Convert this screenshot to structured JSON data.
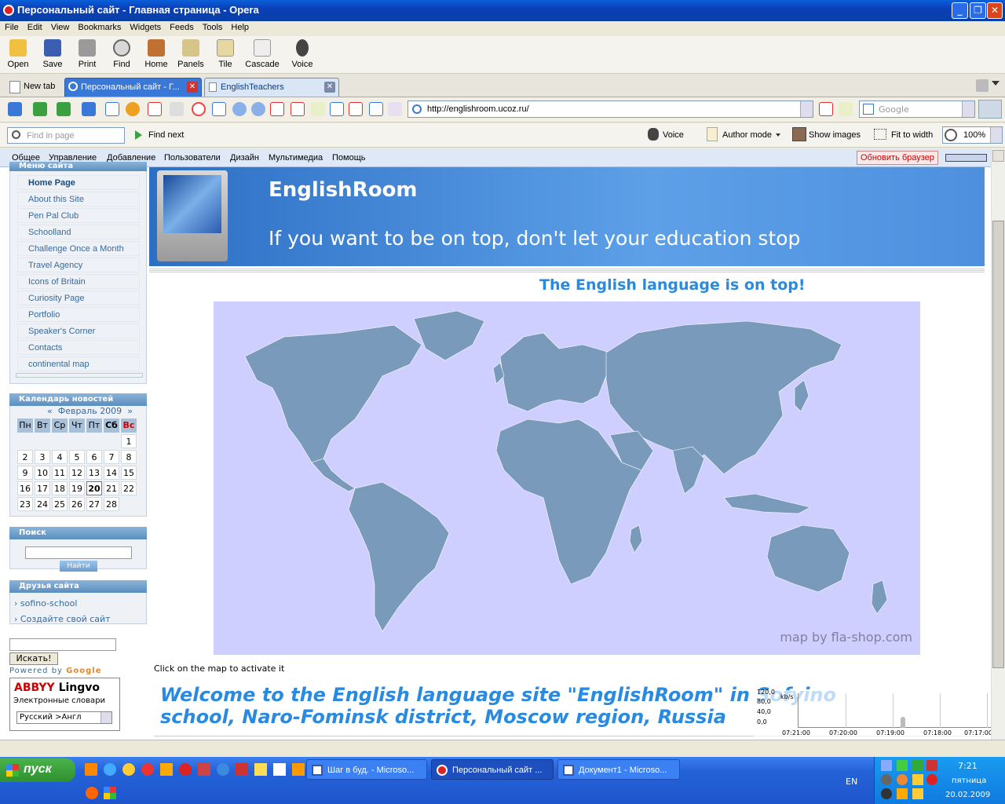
{
  "window": {
    "title": "Персональный сайт - Главная страница - Opera"
  },
  "menubar": [
    "File",
    "Edit",
    "View",
    "Bookmarks",
    "Widgets",
    "Feeds",
    "Tools",
    "Help"
  ],
  "toolbar": {
    "open": "Open",
    "save": "Save",
    "print": "Print",
    "find": "Find",
    "home": "Home",
    "panels": "Panels",
    "tile": "Tile",
    "cascade": "Cascade",
    "voice": "Voice"
  },
  "tabs": {
    "new_tab": "New tab",
    "tab1": "Персональный сайт - Г...",
    "tab2": "EnglishTeachers"
  },
  "address": {
    "url": "http://englishroom.ucoz.ru/",
    "search_placeholder": "Google"
  },
  "findbar": {
    "placeholder": "Find in page",
    "find_next": "Find next",
    "voice": "Voice",
    "author_mode": "Author mode",
    "show_images": "Show images",
    "fit_to_width": "Fit to width",
    "zoom": "100%"
  },
  "ucoz_bar": {
    "items": [
      "Общее",
      "Управление",
      "Добавление",
      "Пользователи",
      "Дизайн",
      "Мультимедиа",
      "Помощь"
    ],
    "refresh": "Обновить браузер"
  },
  "site": {
    "menu_header": "Меню сайта",
    "menu": [
      "Home Page",
      "About this Site",
      "Pen Pal Club",
      "Schoolland",
      "Challenge Once a Month",
      "Travel Agency",
      "Icons of Britain",
      "Curiosity Page",
      "Portfolio",
      "Speaker's Corner",
      "Contacts",
      "continental map"
    ],
    "calendar_header": "Календарь новостей",
    "calendar_month": "Февраль 2009",
    "calendar_prev": "«",
    "calendar_next": "»",
    "weekdays": [
      "Пн",
      "Вт",
      "Ср",
      "Чт",
      "Пт",
      "Сб",
      "Вс"
    ],
    "days": [
      "",
      "",
      "",
      "",
      "",
      "",
      "1",
      "2",
      "3",
      "4",
      "5",
      "6",
      "7",
      "8",
      "9",
      "10",
      "11",
      "12",
      "13",
      "14",
      "15",
      "16",
      "17",
      "18",
      "19",
      "20",
      "21",
      "22",
      "23",
      "24",
      "25",
      "26",
      "27",
      "28",
      ""
    ],
    "today": "20",
    "search_header": "Поиск",
    "search_button": "Найти",
    "friends_header": "Друзья сайта",
    "friends": [
      "sofino-school",
      "Создайте свой сайт"
    ],
    "google_button": "Искать!",
    "powered_by": "Powered by",
    "google_word": "Google",
    "lingvo_title1": "ABBYY",
    "lingvo_title2": "Lingvo",
    "lingvo_sub": "Электронные словари",
    "lingvo_select": "Русский >Англ",
    "banner_title": "EnglishRoom",
    "banner_slogan": "If you want to be on top, don't let your education stop",
    "tagline": "The English language is on top!",
    "map_credit": "map by fla-shop.com",
    "map_hint": "Click on the map to activate it",
    "welcome": "Welcome to the English language site \"EnglishRoom\" in Sofyino school, Naro-Fominsk district, Moscow region, Russia"
  },
  "graph": {
    "y_labels": [
      "120,0",
      "80,0",
      "40,0",
      "0,0"
    ],
    "x_labels": [
      "07:21:00",
      "07:20:00",
      "07:19:00",
      "07:18:00",
      "07:17:00"
    ],
    "unit": "kb/s"
  },
  "taskbar": {
    "start": "пуск",
    "tasks": [
      "Шаг в буд. - Microso...",
      "Персональный сайт ...",
      "Документ1 - Microso..."
    ],
    "lang": "EN",
    "time": "7:21",
    "weekday": "пятница",
    "date": "20.02.2009"
  },
  "colors": {
    "accent": "#3a8ee6",
    "map_bg": "#cfcfff",
    "land": "#7a9abb"
  }
}
